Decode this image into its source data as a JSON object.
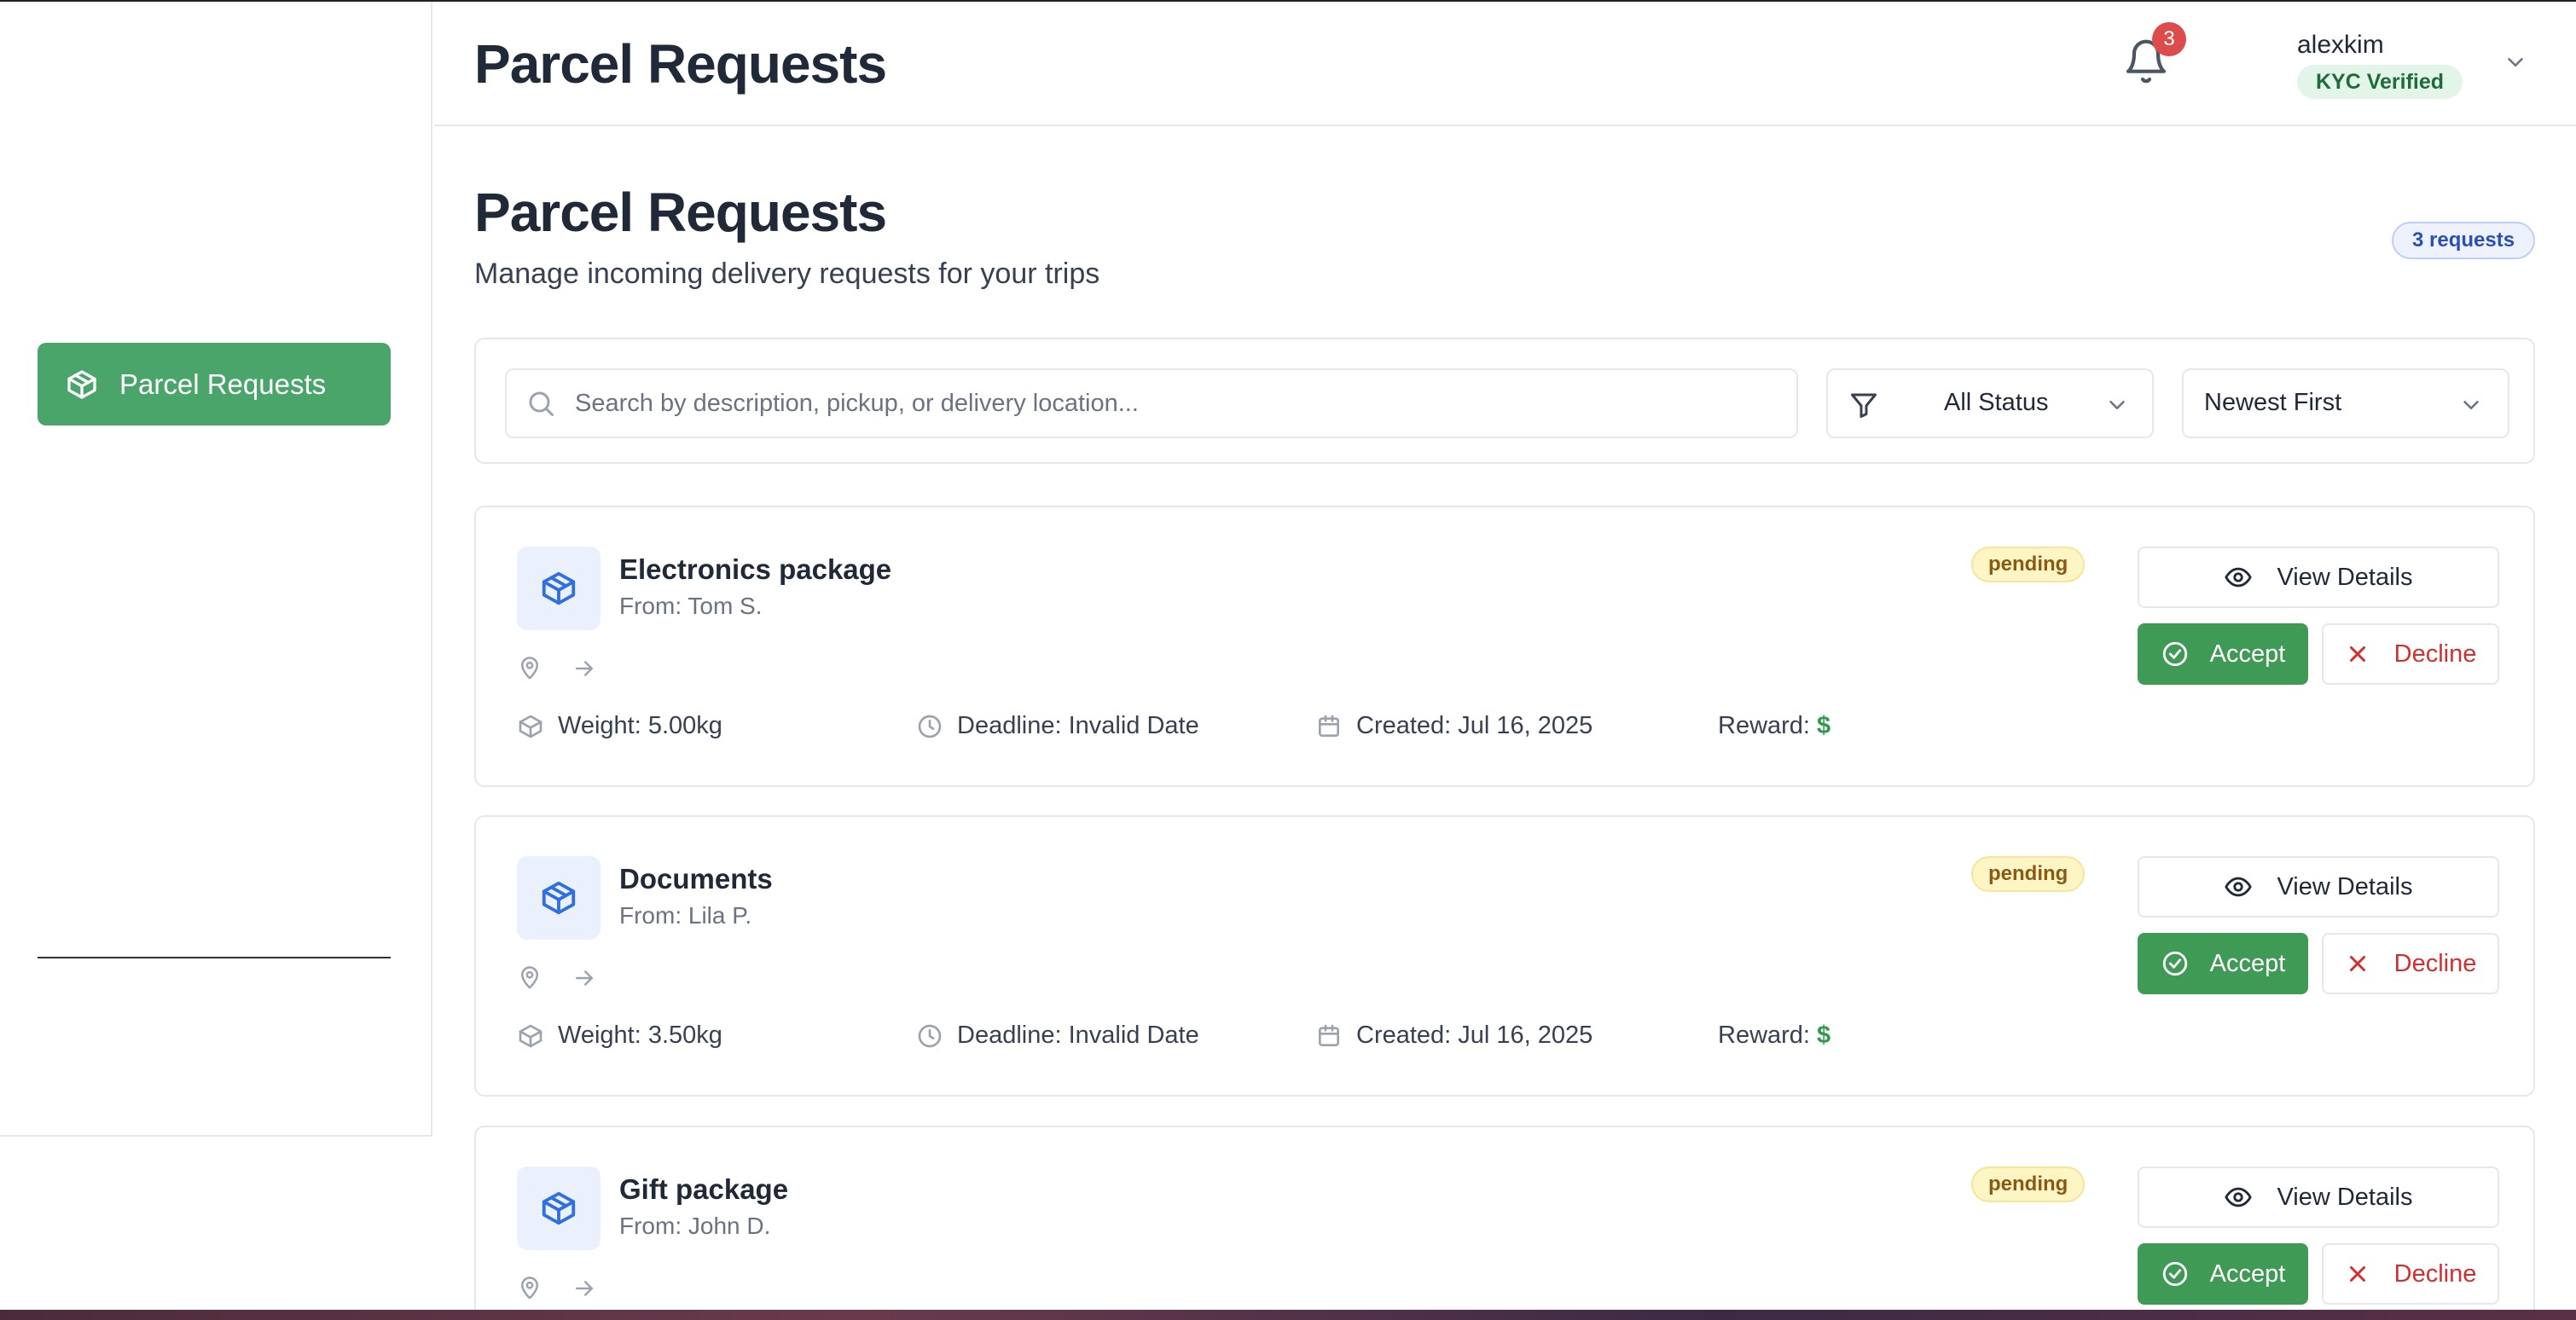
{
  "sidebar": {
    "items": [
      {
        "label": "Parcel Requests",
        "icon": "package-icon",
        "active": true
      }
    ]
  },
  "header": {
    "title": "Parcel Requests",
    "notifications_count": "3",
    "user": {
      "name": "alexkim",
      "kyc_status": "KYC Verified"
    }
  },
  "page": {
    "title": "Parcel Requests",
    "subtitle": "Manage incoming delivery requests for your trips",
    "count_label": "3 requests"
  },
  "filters": {
    "search_placeholder": "Search by description, pickup, or delivery location...",
    "status_value": "All Status",
    "sort_value": "Newest First"
  },
  "requests": [
    {
      "title": "Electronics package",
      "from": "From: Tom S.",
      "weight": "Weight: 5.00kg",
      "deadline": "Deadline: Invalid Date",
      "created": "Created: Jul 16, 2025",
      "reward_label": "Reward:",
      "reward_value": "$",
      "status": "pending"
    },
    {
      "title": "Documents",
      "from": "From: Lila P.",
      "weight": "Weight: 3.50kg",
      "deadline": "Deadline: Invalid Date",
      "created": "Created: Jul 16, 2025",
      "reward_label": "Reward:",
      "reward_value": "$",
      "status": "pending"
    },
    {
      "title": "Gift package",
      "from": "From: John D.",
      "weight": "",
      "deadline": "",
      "created": "",
      "reward_label": "",
      "reward_value": "",
      "status": "pending"
    }
  ],
  "actions": {
    "view_label": "View Details",
    "accept_label": "Accept",
    "decline_label": "Decline"
  },
  "colors": {
    "primary_green": "#4aa56b",
    "accept_green": "#3f9a56",
    "decline_red": "#d42f2f",
    "badge_red": "#dc4c4c",
    "pending_bg": "#fdf5c4",
    "info_blue": "#2a4fb5"
  }
}
